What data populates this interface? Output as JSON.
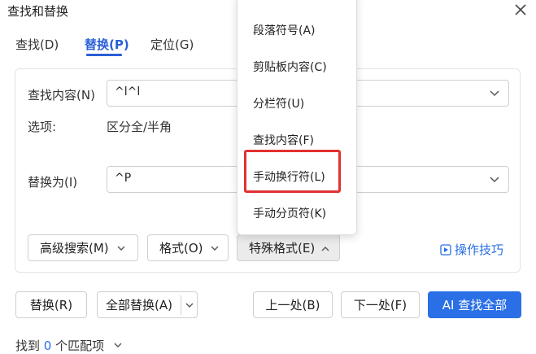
{
  "window": {
    "title": "查找和替换"
  },
  "tabs": [
    {
      "label": "查找(D)"
    },
    {
      "label": "替换(P)"
    },
    {
      "label": "定位(G)"
    }
  ],
  "find": {
    "label": "查找内容(N)",
    "value": "^l^l"
  },
  "options": {
    "label": "选项:",
    "value": "区分全/半角"
  },
  "replace": {
    "label": "替换为(I)",
    "value": "^P"
  },
  "panel_buttons": {
    "advanced": "高级搜索(M)",
    "format": "格式(O)",
    "special": "特殊格式(E)"
  },
  "help_link": "操作技巧",
  "menu": {
    "items": [
      "段落符号(A)",
      "剪贴板内容(C)",
      "分栏符(U)",
      "查找内容(F)",
      "手动换行符(L)",
      "手动分页符(K)"
    ],
    "highlight_index": 4
  },
  "actions": {
    "replace": "替换(R)",
    "replace_all": "全部替换(A)",
    "prev": "上一处(B)",
    "next": "下一处(F)",
    "ai_find_all": "AI 查找全部"
  },
  "status": {
    "prefix": "找到",
    "count": "0",
    "suffix": "个匹配项"
  },
  "colors": {
    "accent": "#2a6fe6",
    "highlight": "#e23030"
  }
}
